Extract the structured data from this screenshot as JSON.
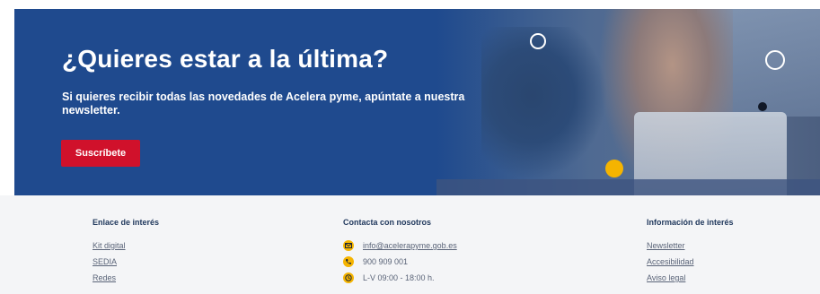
{
  "banner": {
    "title": "¿Quieres estar a la última?",
    "text": "Si quieres recibir todas las novedades de Acelera pyme, apúntate a nuestra newsletter.",
    "button_label": "Suscríbete"
  },
  "footer": {
    "interest_links": {
      "heading": "Enlace de interés",
      "items": [
        "Kit digital",
        "SEDIA",
        "Redes"
      ]
    },
    "contact": {
      "heading": "Contacta con nosotros",
      "email": "info@acelerapyme.gob.es",
      "phone": "900 909 001",
      "hours": "L-V 09:00 - 18:00 h."
    },
    "info": {
      "heading": "Información de interés",
      "items": [
        "Newsletter",
        "Accesibilidad",
        "Aviso legal"
      ]
    }
  },
  "colors": {
    "banner_blue": "#1f4a8e",
    "button_red": "#d0112b",
    "accent_yellow": "#f5b400",
    "footer_bg": "#f4f5f7"
  },
  "icons": [
    "email-icon",
    "phone-icon",
    "clock-icon"
  ]
}
